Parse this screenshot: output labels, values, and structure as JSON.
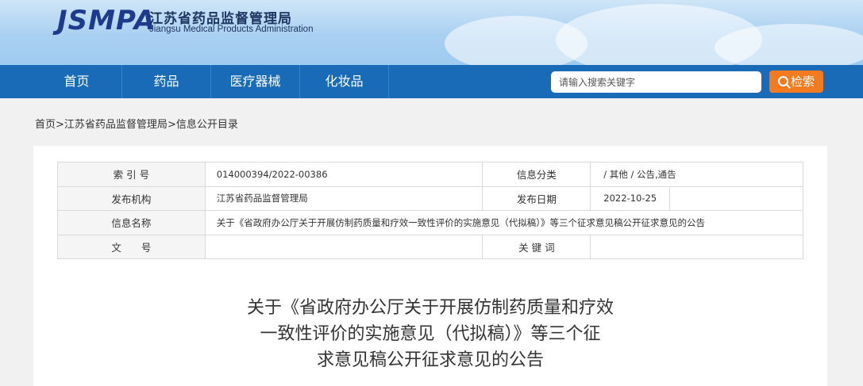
{
  "header": {
    "logo_text": "JSMPA",
    "org_name_cn": "江苏省药品监督管理局",
    "org_name_en": "Jiangsu Medical Products Administration"
  },
  "nav": {
    "items": [
      {
        "label": "首页"
      },
      {
        "label": "药品"
      },
      {
        "label": "医疗器械"
      },
      {
        "label": "化妆品"
      }
    ],
    "search_placeholder": "请输入搜索关键字",
    "search_button": "检索"
  },
  "breadcrumb": {
    "home": "首页",
    "sep1": ">",
    "org": "江苏省药品监督管理局",
    "sep2": ">",
    "current": "信息公开目录"
  },
  "info_table": {
    "index_label": "索 引 号",
    "index_value": "014000394/2022-00386",
    "category_label": "信息分类",
    "category_value": "/ 其他 / 公告,通告",
    "publisher_label": "发布机构",
    "publisher_value": "江苏省药品监督管理局",
    "date_label": "发布日期",
    "date_value": "2022-10-25",
    "name_label": "信息名称",
    "name_value": "关于《省政府办公厅关于开展仿制药质量和疗效一致性评价的实施意见（代拟稿）》等三个征求意见稿公开征求意见的公告",
    "docno_label": "文　　号",
    "docno_value": "",
    "keywords_label": "关 键 词",
    "keywords_value": ""
  },
  "article": {
    "title_line1": "关于《省政府办公厅关于开展仿制药质量和疗效",
    "title_line2": "一致性评价的实施意见（代拟稿）》等三个征",
    "title_line3": "求意见稿公开征求意见的公告"
  },
  "colors": {
    "nav_bg": "#1a6bb7",
    "search_button": "#f47a20",
    "logo": "#1d3a8c"
  }
}
